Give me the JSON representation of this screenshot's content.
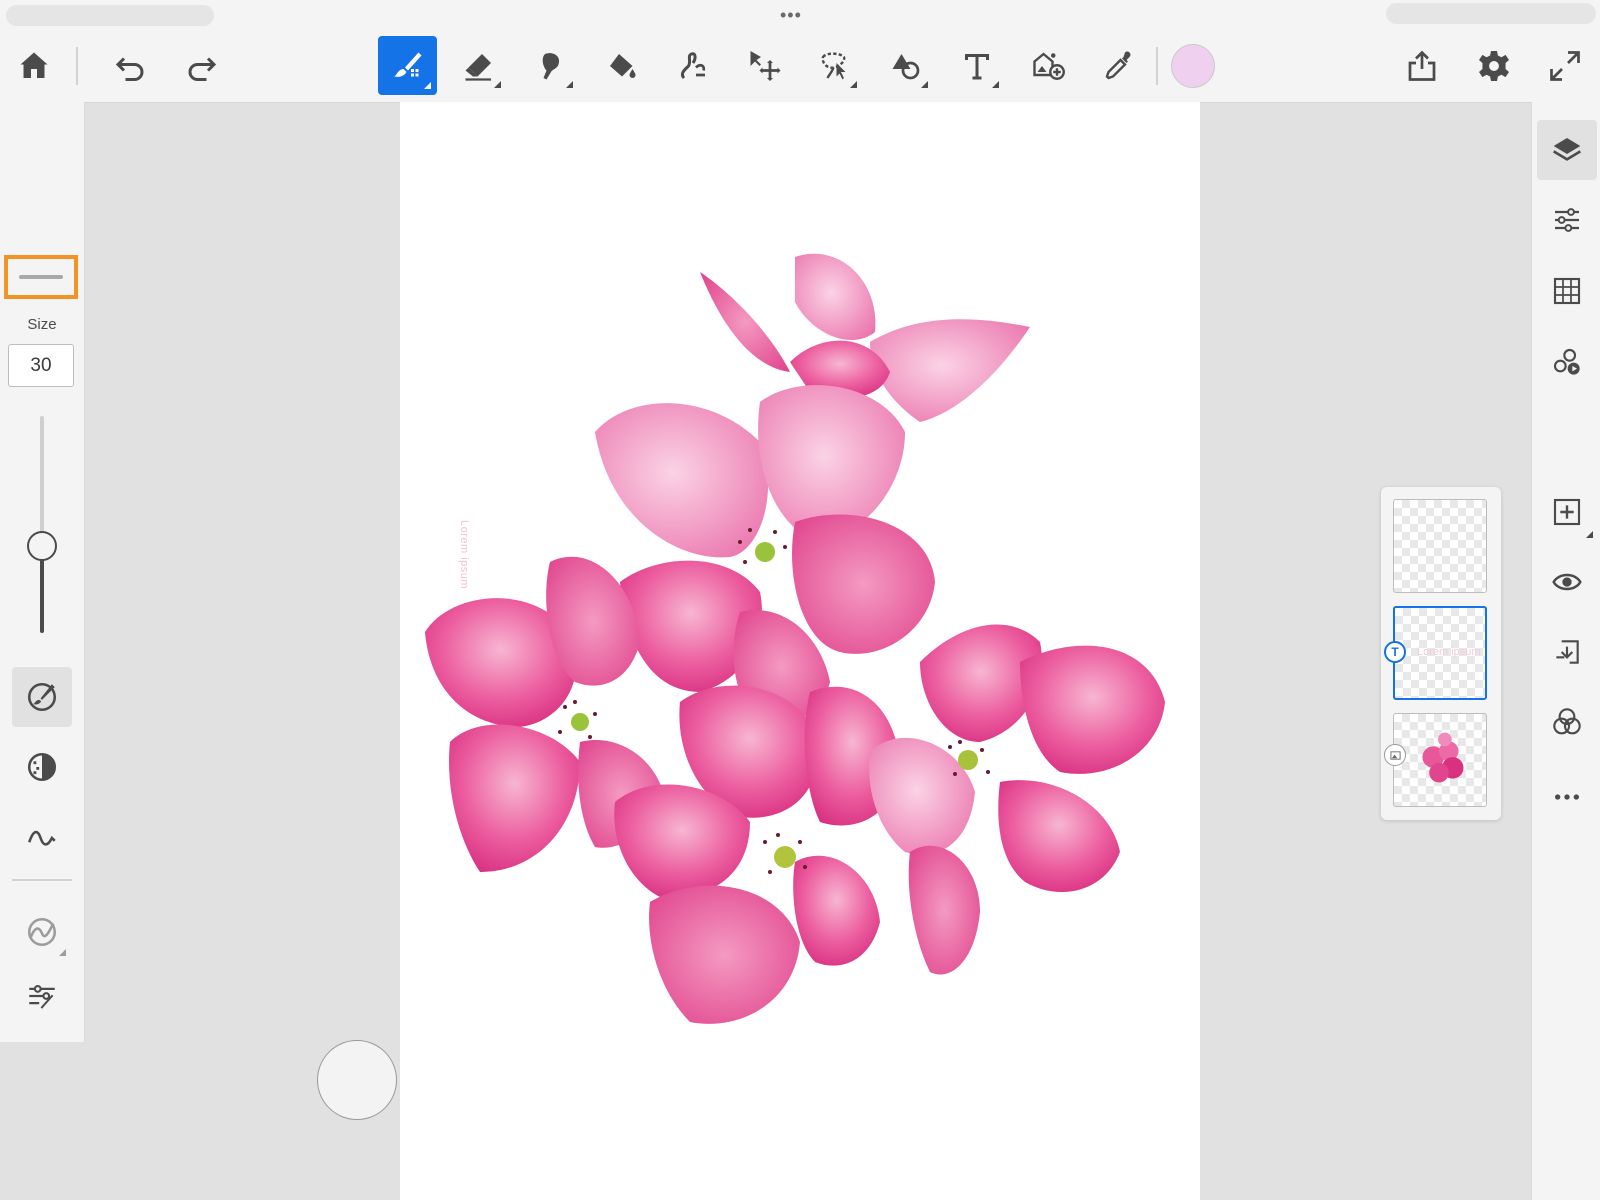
{
  "toolbar": {
    "tools": [
      {
        "id": "home",
        "icon": "home-icon"
      },
      {
        "id": "undo",
        "icon": "undo-icon"
      },
      {
        "id": "redo",
        "icon": "redo-icon"
      },
      {
        "id": "brush",
        "icon": "brush-icon",
        "active": true
      },
      {
        "id": "eraser",
        "icon": "eraser-icon"
      },
      {
        "id": "smudge",
        "icon": "smudge-icon"
      },
      {
        "id": "fill",
        "icon": "paint-bucket-icon"
      },
      {
        "id": "liquify",
        "icon": "liquify-icon"
      },
      {
        "id": "transform",
        "icon": "move-transform-icon"
      },
      {
        "id": "select",
        "icon": "lasso-select-icon"
      },
      {
        "id": "shape",
        "icon": "shape-icon"
      },
      {
        "id": "text",
        "icon": "text-icon"
      },
      {
        "id": "image",
        "icon": "place-image-icon"
      },
      {
        "id": "eyedropper",
        "icon": "eyedropper-icon"
      },
      {
        "id": "share",
        "icon": "share-icon"
      },
      {
        "id": "settings",
        "icon": "gear-icon"
      },
      {
        "id": "fullscreen",
        "icon": "fullscreen-icon"
      }
    ],
    "current_color": "#efd0ef",
    "accent": "#1473e6"
  },
  "brush_settings": {
    "size_label": "Size",
    "size_value": "30",
    "size_slider_fraction": 0.4,
    "highlight_color": "#f29423"
  },
  "left_tools": [
    {
      "id": "brush-settings",
      "icon": "brush-settings-icon",
      "selected": true
    },
    {
      "id": "opacity",
      "icon": "opacity-icon"
    },
    {
      "id": "flow",
      "icon": "flow-icon"
    },
    {
      "id": "pressure",
      "icon": "pressure-icon"
    },
    {
      "id": "adjustments",
      "icon": "adjustments-icon"
    }
  ],
  "canvas": {
    "vertical_text": "Lorem ipsum"
  },
  "layers": [
    {
      "type": "empty"
    },
    {
      "type": "text",
      "label": "Lorem ipsum",
      "selected": true
    },
    {
      "type": "image"
    }
  ],
  "right_tools": [
    {
      "id": "layers",
      "icon": "layers-icon",
      "selected": true
    },
    {
      "id": "properties",
      "icon": "properties-sliders-icon"
    },
    {
      "id": "grid",
      "icon": "grid-icon"
    },
    {
      "id": "libraries",
      "icon": "libraries-icon"
    },
    {
      "id": "add-layer",
      "icon": "add-layer-icon"
    },
    {
      "id": "visibility",
      "icon": "eye-icon"
    },
    {
      "id": "merge-down",
      "icon": "merge-down-icon"
    },
    {
      "id": "blend",
      "icon": "blend-icon"
    },
    {
      "id": "more",
      "icon": "more-icon"
    }
  ]
}
